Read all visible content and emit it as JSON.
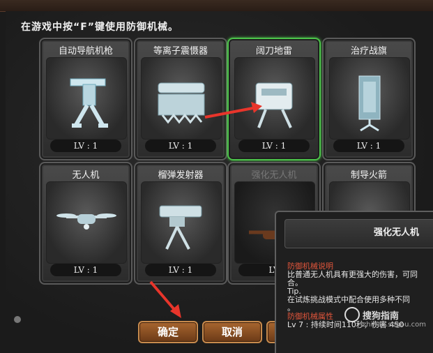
{
  "instruction": "在游戏中按“F”键使用防御机械。",
  "cards": [
    {
      "title": "自动导航机枪",
      "level": "LV : 1",
      "icon": "turret-robot-icon"
    },
    {
      "title": "等离子震慑器",
      "level": "LV : 1",
      "icon": "plasma-device-icon"
    },
    {
      "title": "阔刀地雷",
      "level": "LV : 1",
      "icon": "claymore-mine-icon",
      "selected": true
    },
    {
      "title": "治疗战旗",
      "level": "LV : 1",
      "icon": "healing-banner-icon"
    },
    {
      "title": "无人机",
      "level": "LV : 1",
      "icon": "drone-icon"
    },
    {
      "title": "榴弹发射器",
      "level": "LV : 1",
      "icon": "grenade-launcher-icon"
    },
    {
      "title": "强化无人机",
      "level": "LV",
      "icon": "enhanced-drone-icon",
      "dim": true
    },
    {
      "title": "制导火箭",
      "level": "",
      "icon": "guided-rocket-icon"
    }
  ],
  "buttons": {
    "confirm": "确定",
    "cancel": "取消"
  },
  "tooltip": {
    "title": "强化无人机",
    "section1": "防御机械说明",
    "desc1": "比普通无人机具有更强大的伤害，可同",
    "desc2": "合。",
    "tip_label": "Tip.",
    "tip_text": "在试炼挑战模式中配合使用多种不同",
    "blank": "。",
    "section2": "防御机械属性",
    "attr": "Lv 7 : 持续时间110秒，伤害 450"
  },
  "watermark": {
    "name": "搜狗指南",
    "url": "zhinan.sogou.com"
  },
  "colors": {
    "selected_border": "#4cc34a",
    "arrow": "#e8352b",
    "section_red": "#e0553b"
  }
}
